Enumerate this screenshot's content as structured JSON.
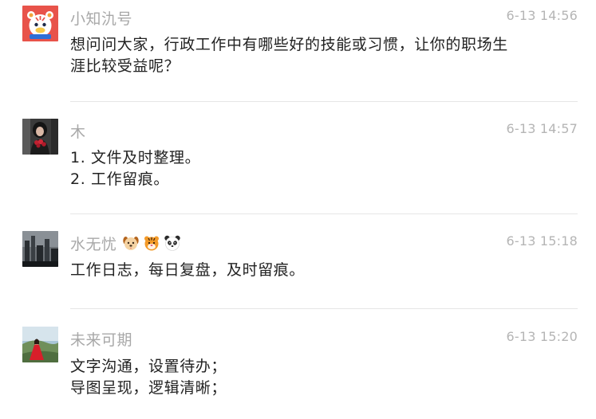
{
  "comments": [
    {
      "username": "小知氿号",
      "time": "6-13 14:56",
      "lines": [
        "想问问大家，行政工作中有哪些好的技能或习惯，让你的职场生",
        "涯比较受益呢？"
      ],
      "avatar": "tiger-mascot"
    },
    {
      "username": "木",
      "time": "6-13 14:57",
      "lines": [
        "1. 文件及时整理。",
        "2. 工作留痕。"
      ],
      "avatar": "person-with-roses"
    },
    {
      "username": "水无忧",
      "emojis": [
        "dog-face-icon",
        "tiger-face-icon",
        "panda-face-icon"
      ],
      "time": "6-13 15:18",
      "lines": [
        "工作日志，每日复盘，及时留痕。"
      ],
      "avatar": "city-skyline"
    },
    {
      "username": "未来可期",
      "time": "6-13 15:20",
      "lines": [
        "文字沟通，设置待办；",
        "导图呈现，逻辑清晰；"
      ],
      "avatar": "woman-in-red-dress"
    }
  ],
  "colors": {
    "username": "#a8a8a8",
    "time": "#b5b5b5",
    "text": "#222222",
    "divider": "#e6e6e6",
    "brand_red": "#e8534a"
  }
}
